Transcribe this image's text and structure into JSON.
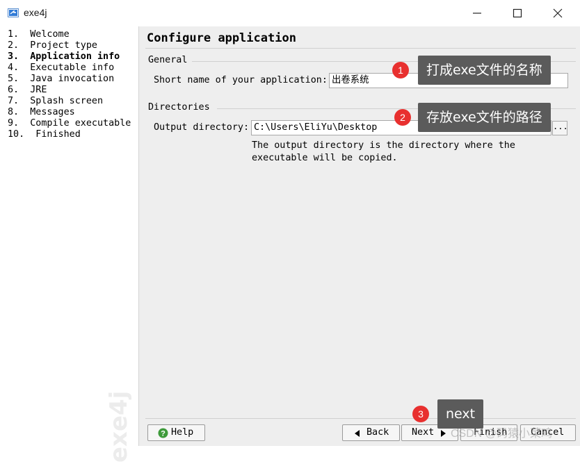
{
  "window": {
    "title": "exe4j"
  },
  "steps": [
    "1.  Welcome",
    "2.  Project type",
    "3.  Application info",
    "4.  Executable info",
    "5.  Java invocation",
    "6.  JRE",
    "7.  Splash screen",
    "8.  Messages",
    "9.  Compile executable",
    "10.  Finished"
  ],
  "active_step_index": 2,
  "watermark": "exe4j",
  "main": {
    "heading": "Configure application",
    "general": {
      "section_label": "General",
      "short_name_label": "Short name of your application:",
      "short_name_value": "出卷系统"
    },
    "directories": {
      "section_label": "Directories",
      "output_label": "Output directory:",
      "output_value": "C:\\Users\\EliYu\\Desktop",
      "browse_label": "...",
      "hint": "The output directory is the directory where the executable will be copied."
    }
  },
  "footer": {
    "help_label": "Help",
    "back_label": "Back",
    "next_label": "Next",
    "finish_label": "Finish",
    "cancel_label": "Cancel"
  },
  "annotations": [
    {
      "number": "1",
      "text": "打成exe文件的名称"
    },
    {
      "number": "2",
      "text": "存放exe文件的路径"
    },
    {
      "number": "3",
      "text": "next"
    }
  ],
  "credit": "CSDN @码猿小菜鸡",
  "colors": {
    "badge": "#e8302f",
    "callout": "#5b5b5b",
    "panel": "#eeeeee",
    "help_icon": "#3d9a3a"
  }
}
